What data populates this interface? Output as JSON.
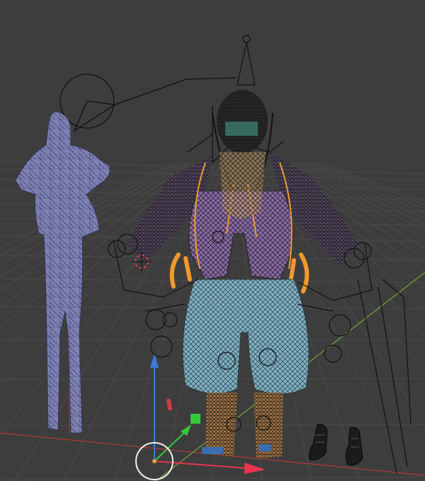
{
  "viewport": {
    "background": "#3d3d3d",
    "grid_color": "#4a4a4a",
    "axis_x_color": "#d13a3a",
    "axis_y_color": "#8ccf3c",
    "gizmo_z_color": "#3a7ad9",
    "gizmo_y_color": "#35c93a",
    "gizmo_x_color": "#e8344e"
  },
  "objects": {
    "reference_figure": {
      "name": "lowpoly-woman-figure",
      "color": "#7d80b3"
    },
    "main_character": {
      "name": "rigged-character",
      "cloth_color": "#7fb2c7",
      "vest_color": "#8a6aa6",
      "selected_outline": "#f09a2c",
      "wire_color": "#1a1a1a"
    },
    "boots": {
      "name": "boots-pair",
      "color": "#1b1b1b"
    },
    "lamp": {
      "name": "lamp-object"
    },
    "camera": {
      "name": "camera-object"
    }
  },
  "cursor": {
    "name": "3d-cursor",
    "color": "#e0404a"
  }
}
